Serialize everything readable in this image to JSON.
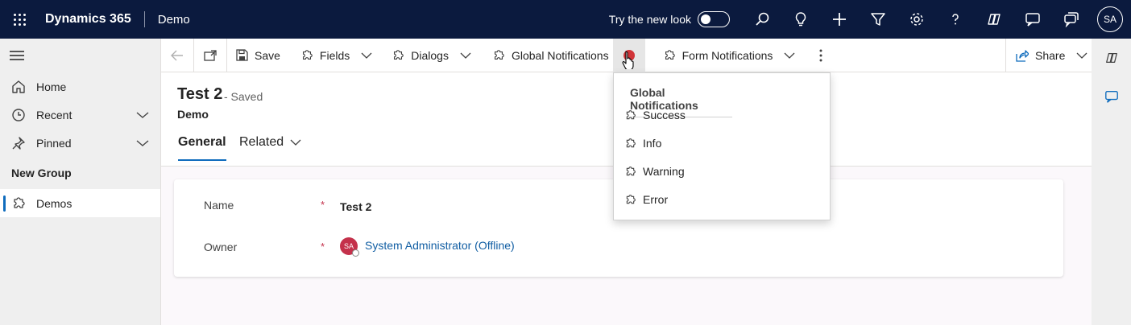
{
  "topbar": {
    "app_name": "Dynamics 365",
    "environment": "Demo",
    "try_new_look": "Try the new look",
    "avatar_initials": "SA",
    "icons": [
      "search-icon",
      "lightbulb-icon",
      "plus-icon",
      "filter-icon",
      "gear-icon",
      "help-icon",
      "copilot-icon",
      "chat-icon",
      "teams-chat-icon"
    ]
  },
  "sidebar": {
    "items": [
      {
        "label": "Home",
        "icon": "home-icon"
      },
      {
        "label": "Recent",
        "icon": "clock-icon"
      },
      {
        "label": "Pinned",
        "icon": "pin-icon"
      }
    ],
    "group_title": "New Group",
    "group_items": [
      {
        "label": "Demos",
        "icon": "puzzle-icon"
      }
    ]
  },
  "commandbar": {
    "save": "Save",
    "fields": "Fields",
    "dialogs": "Dialogs",
    "global_notifications": "Global Notifications",
    "form_notifications": "Form Notifications",
    "share": "Share"
  },
  "record": {
    "title": "Test 2",
    "status": "- Saved",
    "entity": "Demo",
    "tabs": {
      "general": "General",
      "related": "Related"
    }
  },
  "form": {
    "name_label": "Name",
    "name_value": "Test 2",
    "owner_label": "Owner",
    "owner_value": "System Administrator (Offline)",
    "owner_initials": "SA",
    "required_marker": "*"
  },
  "menu": {
    "header": "Global Notifications",
    "items": [
      {
        "label": "Success"
      },
      {
        "label": "Info"
      },
      {
        "label": "Warning"
      },
      {
        "label": "Error"
      }
    ]
  },
  "colors": {
    "topbar_bg": "#0b1a3e",
    "accent": "#0f6cbd",
    "required": "#c4314b",
    "notification_dot": "#d13438"
  }
}
